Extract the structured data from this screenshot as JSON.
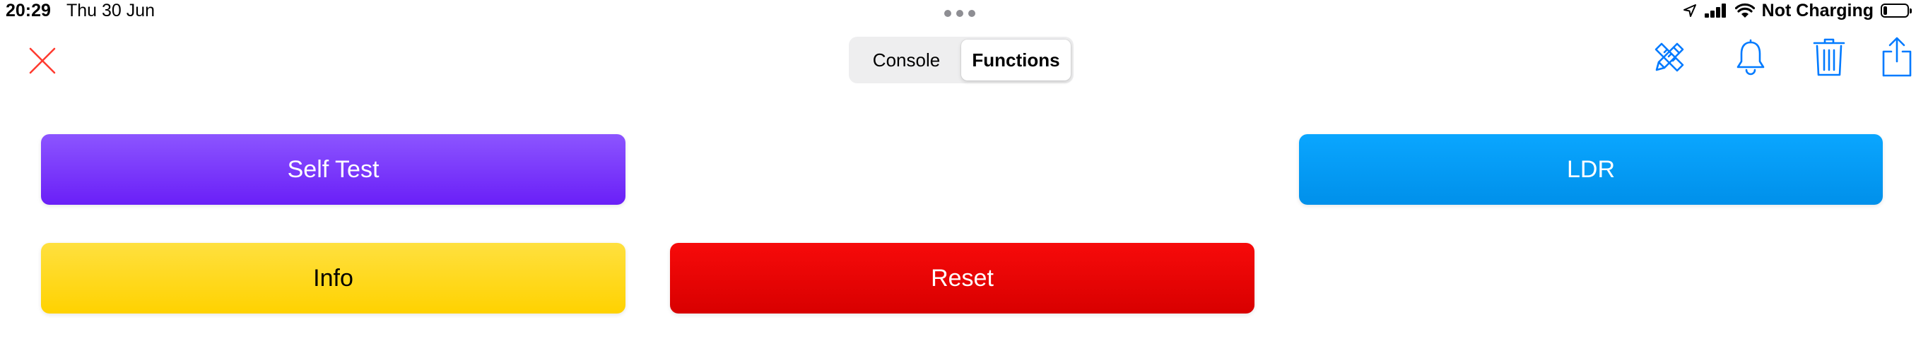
{
  "status_bar": {
    "time": "20:29",
    "date": "Thu 30 Jun",
    "charging_status": "Not Charging",
    "icons": [
      "location-arrow-icon",
      "cellular-signal-icon",
      "wifi-icon",
      "battery-icon"
    ],
    "battery_level": 0.15
  },
  "nav": {
    "close_icon": "close-x-icon",
    "segments": [
      {
        "label": "Console",
        "selected": false
      },
      {
        "label": "Functions",
        "selected": true
      }
    ],
    "toolbar_icons": [
      "edit-tools-icon",
      "bell-icon",
      "trash-icon",
      "share-icon"
    ]
  },
  "actions": {
    "self_test": "Self Test",
    "ldr": "LDR",
    "info": "Info",
    "reset": "Reset"
  },
  "colors": {
    "accent": "#007aff",
    "close": "#ff3b30",
    "self_test": "#7a35fb",
    "ldr": "#009cf6",
    "info": "#ffd91d",
    "reset": "#e70404"
  }
}
